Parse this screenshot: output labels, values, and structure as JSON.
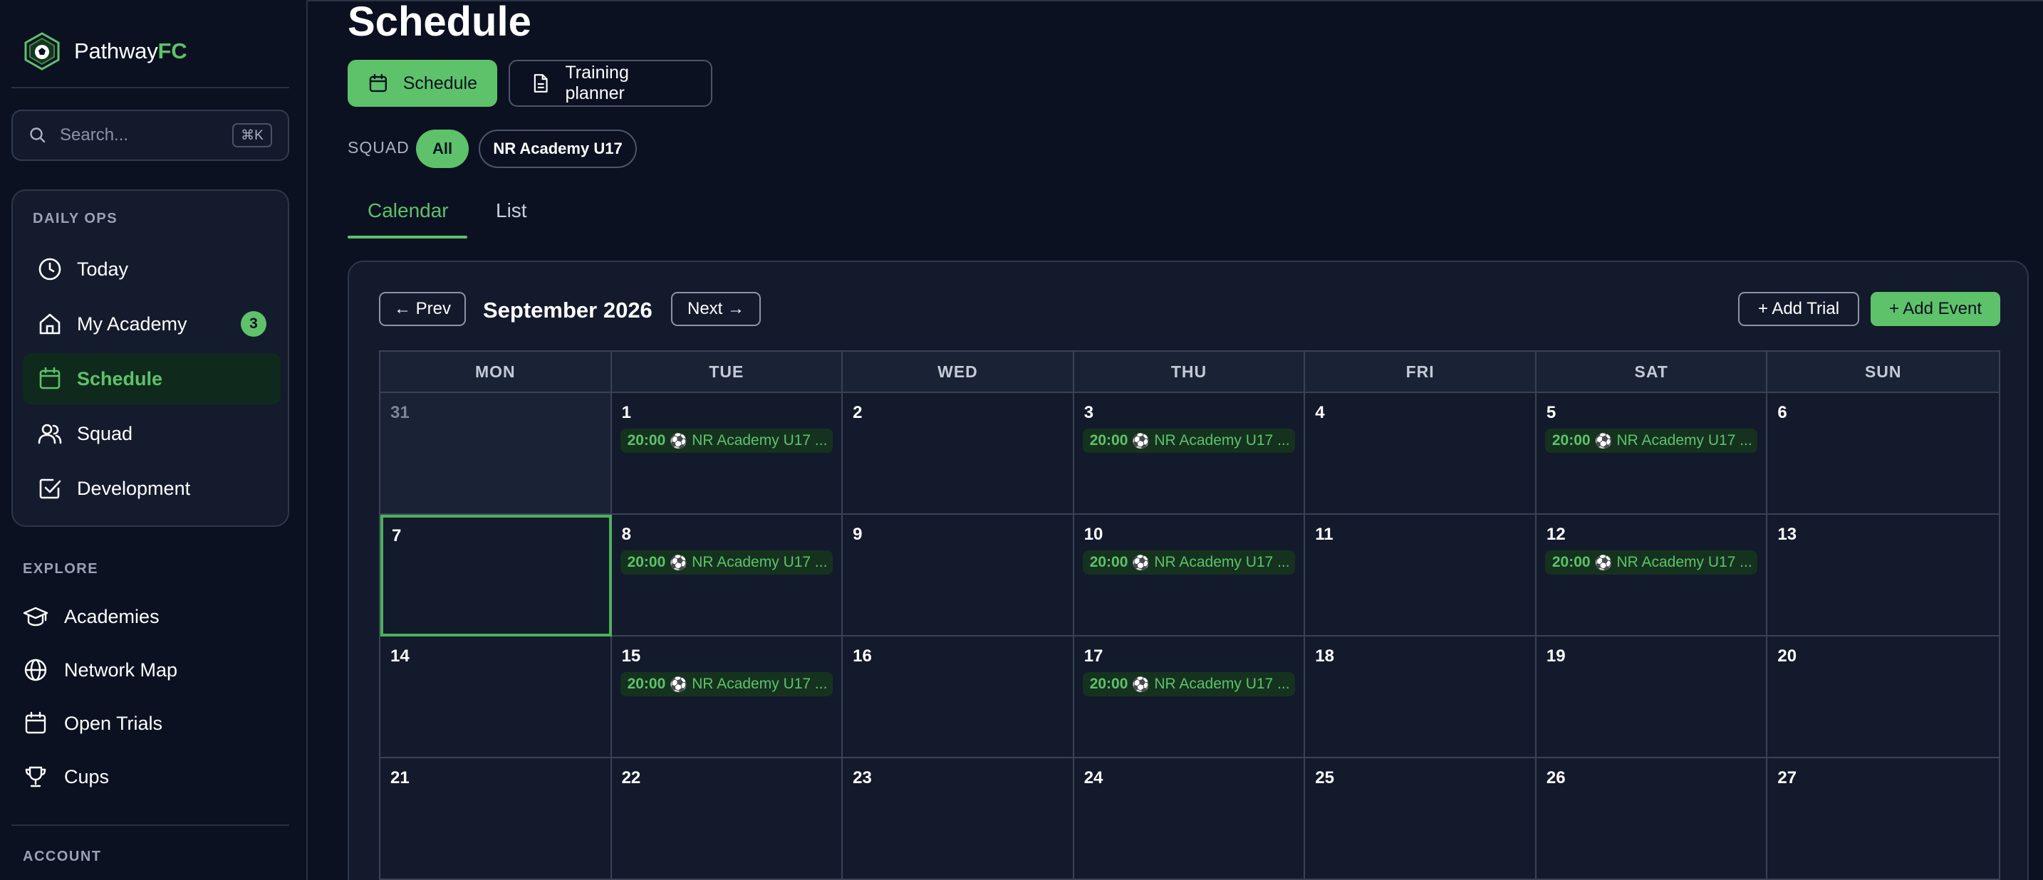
{
  "brand": {
    "name_main": "Pathway",
    "name_accent": "FC"
  },
  "search": {
    "placeholder": "Search...",
    "shortcut": "⌘K"
  },
  "sidebar": {
    "daily_ops_label": "DAILY OPS",
    "daily_ops": [
      {
        "label": "Today",
        "icon": "clock-icon"
      },
      {
        "label": "My Academy",
        "icon": "home-icon",
        "badge": "3"
      },
      {
        "label": "Schedule",
        "icon": "calendar-icon",
        "active": true
      },
      {
        "label": "Squad",
        "icon": "users-icon"
      },
      {
        "label": "Development",
        "icon": "checkbox-icon"
      }
    ],
    "explore_label": "EXPLORE",
    "explore": [
      {
        "label": "Academies",
        "icon": "graduation-cap-icon"
      },
      {
        "label": "Network Map",
        "icon": "globe-icon"
      },
      {
        "label": "Open Trials",
        "icon": "calendar-icon"
      },
      {
        "label": "Cups",
        "icon": "trophy-icon"
      }
    ],
    "account_label": "ACCOUNT"
  },
  "page": {
    "title": "Schedule",
    "view_buttons": {
      "schedule": "Schedule",
      "training": "Training planner"
    },
    "squad_label": "SQUAD",
    "squad_chips": {
      "all": "All",
      "u17": "NR Academy U17"
    },
    "tabs": {
      "calendar": "Calendar",
      "list": "List"
    }
  },
  "calendar": {
    "prev_label": "← Prev",
    "next_label": "Next →",
    "month_title": "September 2026",
    "add_trial_label": "+ Add Trial",
    "add_event_label": "+ Add Event",
    "weekdays": [
      "MON",
      "TUE",
      "WED",
      "THU",
      "FRI",
      "SAT",
      "SUN"
    ],
    "weeks": [
      [
        {
          "day": "31",
          "other": true
        },
        {
          "day": "1",
          "event": {
            "time": "20:00",
            "title": "NR Academy U17 ..."
          }
        },
        {
          "day": "2"
        },
        {
          "day": "3",
          "event": {
            "time": "20:00",
            "title": "NR Academy U17 ..."
          }
        },
        {
          "day": "4"
        },
        {
          "day": "5",
          "event": {
            "time": "20:00",
            "title": "NR Academy U17 ..."
          }
        },
        {
          "day": "6"
        }
      ],
      [
        {
          "day": "7",
          "today": true
        },
        {
          "day": "8",
          "event": {
            "time": "20:00",
            "title": "NR Academy U17 ..."
          }
        },
        {
          "day": "9"
        },
        {
          "day": "10",
          "event": {
            "time": "20:00",
            "title": "NR Academy U17 ..."
          }
        },
        {
          "day": "11"
        },
        {
          "day": "12",
          "event": {
            "time": "20:00",
            "title": "NR Academy U17 ..."
          }
        },
        {
          "day": "13"
        }
      ],
      [
        {
          "day": "14"
        },
        {
          "day": "15",
          "event": {
            "time": "20:00",
            "title": "NR Academy U17 ..."
          }
        },
        {
          "day": "16"
        },
        {
          "day": "17",
          "event": {
            "time": "20:00",
            "title": "NR Academy U17 ..."
          }
        },
        {
          "day": "18"
        },
        {
          "day": "19"
        },
        {
          "day": "20"
        }
      ],
      [
        {
          "day": "21"
        },
        {
          "day": "22"
        },
        {
          "day": "23"
        },
        {
          "day": "24"
        },
        {
          "day": "25"
        },
        {
          "day": "26"
        },
        {
          "day": "27"
        }
      ]
    ],
    "event_icon": "soccer-ball-icon",
    "colors": {
      "accent": "#5ec26a",
      "background": "#0b1121",
      "panel": "#131a2b"
    }
  }
}
